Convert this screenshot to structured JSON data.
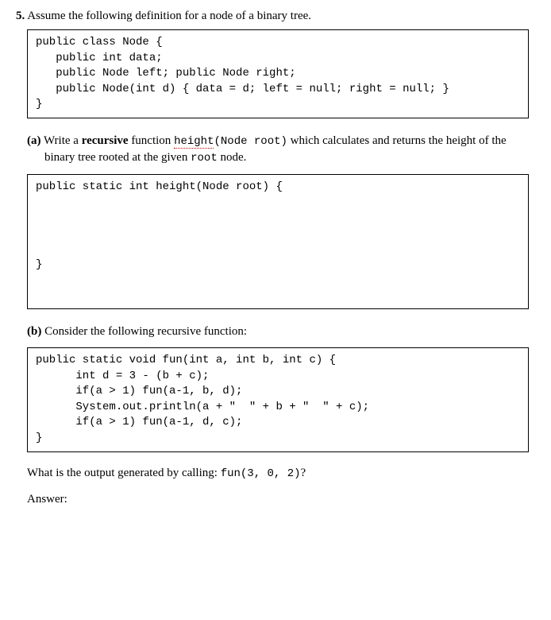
{
  "question": {
    "number": "5.",
    "intro": "Assume the following definition for a node of a binary tree."
  },
  "codebox1": {
    "l1": "public class Node {",
    "l2": "   public int data;",
    "l3": "   public Node left; public Node right;",
    "l4": "   public Node(int d) { data = d; left = null; right = null; }",
    "l5": "}"
  },
  "partA": {
    "label": "(a)",
    "t1": "Write a ",
    "bold1": "recursive",
    "t2": " function ",
    "squiggle": "height",
    "mono_after": "(Node root)",
    "t3": " which calculates and returns the height of the binary tree rooted at the given ",
    "mono2": "root",
    "t4": " node."
  },
  "answerboxA": {
    "l1": "public static int height(Node root) {",
    "l2": "}"
  },
  "partB": {
    "label": "(b)",
    "text": "Consider the following recursive function:"
  },
  "codebox2": {
    "l1": "public static void fun(int a, int b, int c) {",
    "l2": "      int d = 3 - (b + c);",
    "l3": "      if(a > 1) fun(a-1, b, d);",
    "l4": "      System.out.println(a + \"  \" + b + \"  \" + c);",
    "l5": "      if(a > 1) fun(a-1, d, c);",
    "l6": "}"
  },
  "outputQ": {
    "t1": "What is the output generated by calling: ",
    "mono": "fun(3, 0, 2)",
    "t2": "?"
  },
  "answer": {
    "label": "Answer:"
  }
}
